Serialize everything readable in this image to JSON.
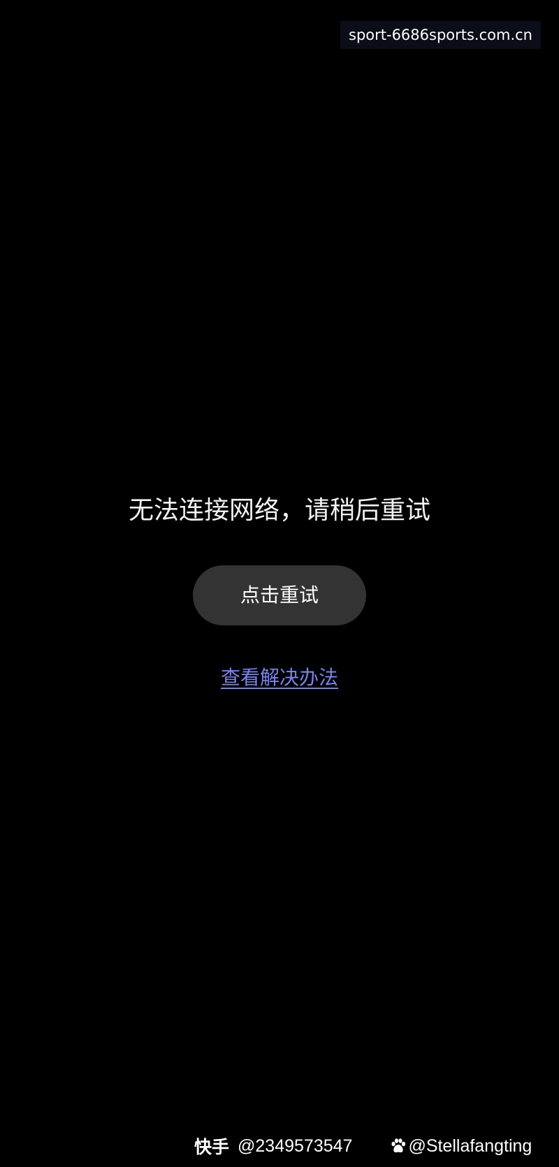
{
  "watermarks": {
    "top_right": "sport-6686sports.com.cn",
    "kuaishou_label": "快手",
    "kuaishou_id": "@2349573547",
    "baidu_icon": "baidu-paw-icon",
    "baidu_id": "@Stellafangting"
  },
  "error": {
    "message": "无法连接网络，请稍后重试",
    "retry_label": "点击重试",
    "solution_link": "查看解决办法"
  },
  "colors": {
    "background": "#000000",
    "button": "#333333",
    "link": "#7b83e6",
    "text": "#ffffff"
  }
}
